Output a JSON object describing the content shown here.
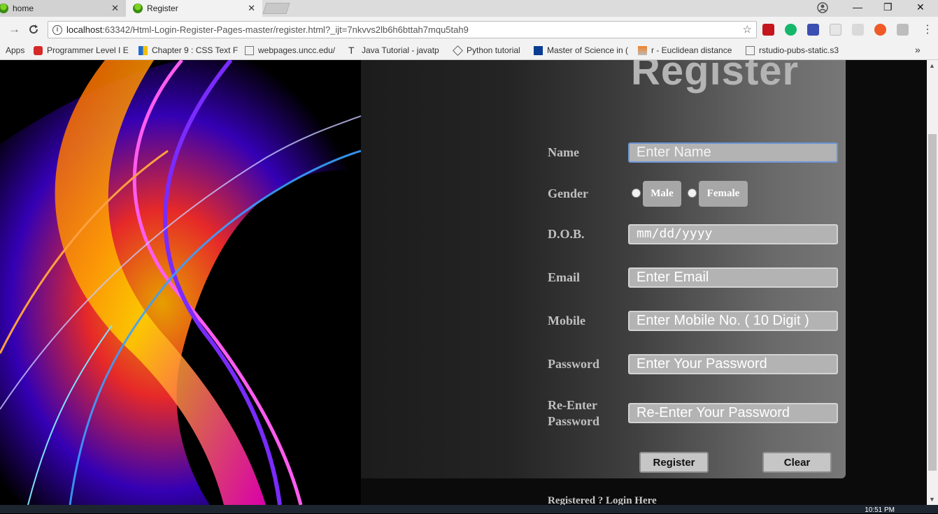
{
  "browser": {
    "tabs": [
      {
        "title": "home",
        "close": "✕"
      },
      {
        "title": "Register",
        "close": "✕"
      }
    ],
    "window_controls": {
      "minimize": "—",
      "restore": "❐",
      "close": "✕"
    },
    "url_host": "localhost",
    "url_rest": ":63342/Html-Login-Register-Pages-master/register.html?_ijt=7nkvvs2lb6h6bttah7mqu5tah9",
    "bookmarks": [
      "Apps",
      "Programmer Level I E",
      "Chapter 9 : CSS Text F",
      "webpages.uncc.edu/",
      "Java Tutorial - javatp",
      "Python tutorial",
      "Master of Science in (",
      "r - Euclidean distance",
      "rstudio-pubs-static.s3"
    ],
    "bookmarks_more": "»"
  },
  "form": {
    "title": "Register",
    "labels": {
      "name": "Name",
      "gender": "Gender",
      "dob": "D.O.B.",
      "email": "Email",
      "mobile": "Mobile",
      "password": "Password",
      "reenter_line1": "Re-Enter",
      "reenter_line2": "Password"
    },
    "placeholders": {
      "name": "Enter Name",
      "dob": "mm/dd/yyyy",
      "email": "Enter Email",
      "mobile": "Enter Mobile No. ( 10 Digit )",
      "password": "Enter Your Password",
      "reenter": "Re-Enter Your Password"
    },
    "gender_options": [
      "Male",
      "Female"
    ],
    "register_button": "Register",
    "clear_button": "Clear",
    "login_link": "Registered ? Login Here"
  },
  "taskbar": {
    "clock": "10:51 PM"
  },
  "colors": {
    "panel_label": "#c0c0c0",
    "input_bg": "#b3b3b3",
    "focus_border": "#6f95d3"
  }
}
